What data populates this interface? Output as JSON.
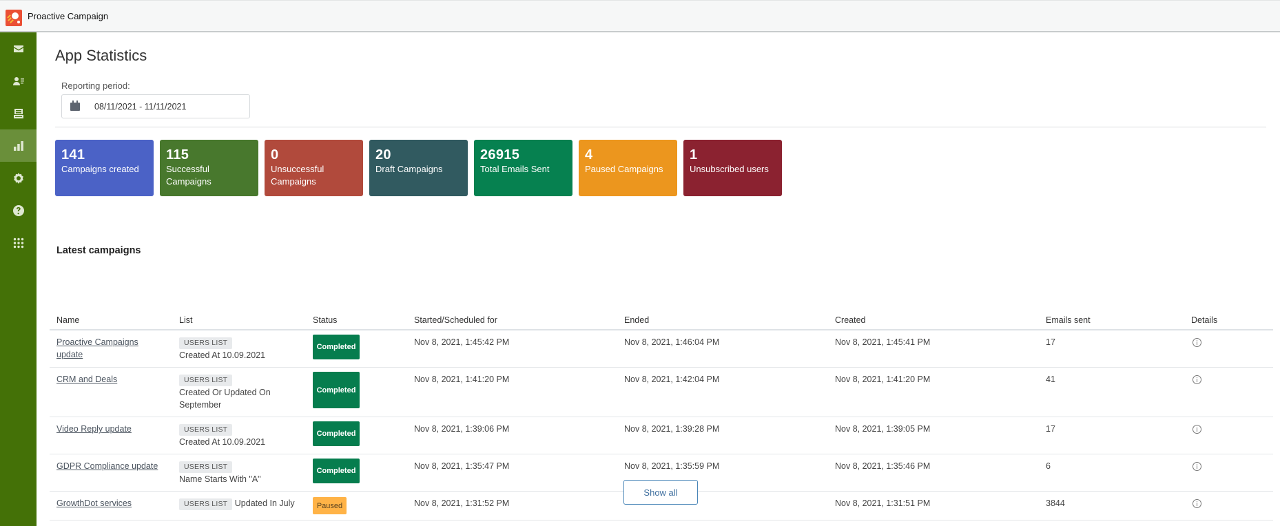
{
  "app": {
    "title": "Proactive Campaign",
    "logo_icon": "proactive-campaign-logo"
  },
  "sidebar": {
    "items": [
      {
        "name": "campaigns",
        "icon": "envelope-icon",
        "active": false
      },
      {
        "name": "contacts",
        "icon": "user-list-icon",
        "active": false
      },
      {
        "name": "templates",
        "icon": "inbox-tray-icon",
        "active": false
      },
      {
        "name": "statistics",
        "icon": "bar-chart-icon",
        "active": true
      },
      {
        "name": "settings",
        "icon": "gear-icon",
        "active": false
      },
      {
        "name": "help",
        "icon": "question-icon",
        "active": false
      },
      {
        "name": "apps",
        "icon": "grid-icon",
        "active": false
      }
    ]
  },
  "page": {
    "title": "App Statistics",
    "reporting_period_label": "Reporting period:",
    "reporting_period_value": "08/11/2021 - 11/11/2021"
  },
  "stats": [
    {
      "value": "141",
      "label": "Campaigns created",
      "color": "#4b62c6"
    },
    {
      "value": "115",
      "label": "Successful Campaigns",
      "color": "#48782d"
    },
    {
      "value": "0",
      "label": "Unsuccessful Campaigns",
      "color": "#b14a3c"
    },
    {
      "value": "20",
      "label": "Draft Campaigns",
      "color": "#315a60"
    },
    {
      "value": "26915",
      "label": "Total Emails Sent",
      "color": "#068150"
    },
    {
      "value": "4",
      "label": "Paused Campaigns",
      "color": "#ec961e"
    },
    {
      "value": "1",
      "label": "Unsubscribed users",
      "color": "#8b2230"
    }
  ],
  "latest": {
    "title": "Latest campaigns",
    "columns": [
      "Name",
      "List",
      "Status",
      "Started/Scheduled for",
      "Ended",
      "Created",
      "Emails sent",
      "Details"
    ],
    "list_badge": "USERS LIST",
    "rows": [
      {
        "name": "Proactive Campaigns update",
        "list": "Created At 10.09.2021",
        "status": "Completed",
        "started": "Nov 8, 2021, 1:45:42 PM",
        "ended": "Nov 8, 2021, 1:46:04 PM",
        "created": "Nov 8, 2021, 1:45:41 PM",
        "emails": "17"
      },
      {
        "name": "CRM and Deals",
        "list": "Created Or Updated On September",
        "status": "Completed",
        "started": "Nov 8, 2021, 1:41:20 PM",
        "ended": "Nov 8, 2021, 1:42:04 PM",
        "created": "Nov 8, 2021, 1:41:20 PM",
        "emails": "41"
      },
      {
        "name": "Video Reply update",
        "list": "Created At 10.09.2021",
        "status": "Completed",
        "started": "Nov 8, 2021, 1:39:06 PM",
        "ended": "Nov 8, 2021, 1:39:28 PM",
        "created": "Nov 8, 2021, 1:39:05 PM",
        "emails": "17"
      },
      {
        "name": "GDPR Compliance update",
        "list": "Name Starts With \"A\"",
        "status": "Completed",
        "started": "Nov 8, 2021, 1:35:47 PM",
        "ended": "Nov 8, 2021, 1:35:59 PM",
        "created": "Nov 8, 2021, 1:35:46 PM",
        "emails": "6"
      },
      {
        "name": "GrowthDot services",
        "list": "Updated In July",
        "status": "Paused",
        "started": "Nov 8, 2021, 1:31:52 PM",
        "ended": "—",
        "created": "Nov 8, 2021, 1:31:51 PM",
        "emails": "3844"
      }
    ],
    "show_all_label": "Show all"
  },
  "colors": {
    "sidebar_bg": "#447107",
    "sidebar_active": "#6a8f3a",
    "status_completed": "#067d4e",
    "status_paused": "#ffb347",
    "button_border": "#4a86b8"
  }
}
